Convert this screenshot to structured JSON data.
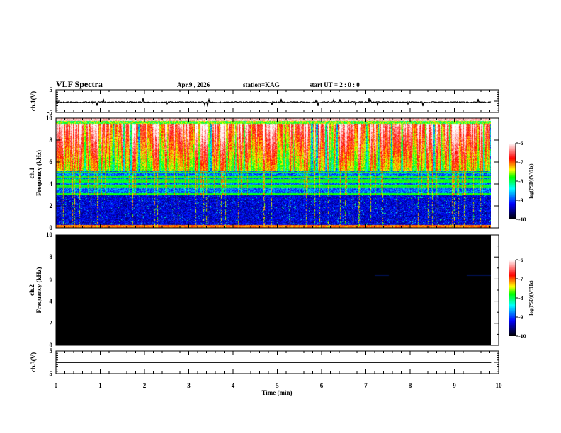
{
  "header": {
    "title": "VLF Spectra",
    "date": "Apr.9 , 2026",
    "station": "station=KAG",
    "start": "start UT =  2 : 0 : 0"
  },
  "chart_data": [
    {
      "type": "line",
      "ylabel": "ch.1(V)",
      "ylim": [
        -5,
        5
      ],
      "yticks": [
        "5",
        "-5"
      ],
      "description_values": "waveform near 0 V with impulsive spikes"
    },
    {
      "type": "heatmap",
      "ylabel": "ch.1\nFrequency (kHz)",
      "ylabel_lines": [
        "ch.1",
        "Frequency (kHz)"
      ],
      "ylim": [
        0,
        10
      ],
      "yticks": [
        "0",
        "2",
        "4",
        "6",
        "8",
        "10"
      ],
      "colorbar": {
        "label": "log(PSD)(V²/Hz)",
        "range": [
          -10,
          -6
        ],
        "ticks": [
          "-6",
          "-7",
          "-8",
          "-9",
          "-10"
        ],
        "colors": [
          "#000000",
          "#0000ff",
          "#00ffff",
          "#00ff00",
          "#ffff00",
          "#ff0000",
          "#ffffff"
        ]
      }
    },
    {
      "type": "heatmap",
      "ylabel_lines": [
        "ch.2",
        "Frequency (kHz)"
      ],
      "ylim": [
        0,
        10
      ],
      "yticks": [
        "0",
        "2",
        "4",
        "6",
        "8",
        "10"
      ],
      "colorbar": {
        "label": "log(PSD)(V²/Hz)",
        "range": [
          -10,
          -6
        ],
        "ticks": [
          "-6",
          "-7",
          "-8",
          "-9",
          "-10"
        ]
      }
    },
    {
      "type": "line",
      "ylabel": "ch.3(V)",
      "ylim": [
        -5,
        5
      ],
      "yticks": [
        "5",
        "-5"
      ],
      "value": 0
    }
  ],
  "xaxis": {
    "label": "Time (min)",
    "xlim": [
      0,
      10
    ],
    "ticks": [
      "0",
      "1",
      "2",
      "3",
      "4",
      "5",
      "6",
      "7",
      "8",
      "9",
      "10"
    ],
    "data_end": 9.83
  }
}
